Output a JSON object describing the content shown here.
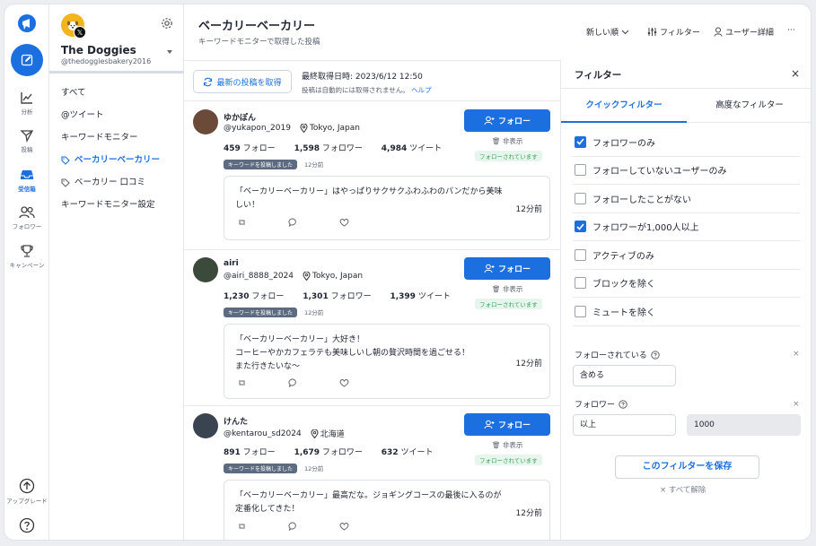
{
  "rail": {
    "items": [
      {
        "label": "分析",
        "icon": "chart-icon"
      },
      {
        "label": "投稿",
        "icon": "send-icon"
      },
      {
        "label": "受信箱",
        "icon": "inbox-icon"
      },
      {
        "label": "フォロワー",
        "icon": "users-icon"
      },
      {
        "label": "キャンペーン",
        "icon": "trophy-icon"
      }
    ],
    "upgrade": "アップグレード",
    "accent": "#1b6fde"
  },
  "account": {
    "name": "The Doggies",
    "handle": "@thedoggiesbakery2016",
    "nav": [
      "すべて",
      "@ツイート",
      "キーワードモニター",
      "ベーカリーベーカリー",
      "ベーカリー 口コミ",
      "キーワードモニター設定"
    ]
  },
  "main": {
    "title": "ベーカリーベーカリー",
    "subtitle": "キーワードモニターで取得した投稿",
    "fetch_button": "最新の投稿を取得",
    "fetch_info": "最終取得日時: 2023/6/12 12:50",
    "fetch_note": "投稿は自動的には取得されません。",
    "help": "ヘルプ"
  },
  "topbar": {
    "sort": "新しい順",
    "filter": "フィルター",
    "user_detail": "ユーザー詳細",
    "more": "···"
  },
  "posts": [
    {
      "name": "ゆかぽん",
      "handle": "@yukapon_2019",
      "location": "Tokyo, Japan",
      "follows": "459",
      "follows_label": "フォロー",
      "followers": "1,598",
      "followers_label": "フォロワー",
      "tweets": "4,984",
      "tweets_label": "ツイート",
      "badge": "キーワードを投稿しました",
      "badge_time": "12分前",
      "follow_button": "フォロー",
      "hide": "非表示",
      "followed_tag": "フォローされています",
      "text": "「ベーカリーベーカリー」はやっぱりサクサクふわふわのパンだから美味しい！",
      "time": "12分前"
    },
    {
      "name": "airi",
      "handle": "@airi_8888_2024",
      "location": "Tokyo, Japan",
      "follows": "1,230",
      "follows_label": "フォロー",
      "followers": "1,301",
      "followers_label": "フォロワー",
      "tweets": "1,399",
      "tweets_label": "ツイート",
      "badge": "キーワードを投稿しました",
      "badge_time": "12分前",
      "follow_button": "フォロー",
      "hide": "非表示",
      "followed_tag": "フォローされています",
      "text": "「ベーカリーベーカリー」大好き！\nコーヒーやかカフェラテも美味しいし朝の贅沢時間を過ごせる！\nまた行きたいな〜",
      "time": "12分前"
    },
    {
      "name": "けんた",
      "handle": "@kentarou_sd2024",
      "location": "北海道",
      "follows": "891",
      "follows_label": "フォロー",
      "followers": "1,679",
      "followers_label": "フォロワー",
      "tweets": "632",
      "tweets_label": "ツイート",
      "badge": "キーワードを投稿しました",
      "badge_time": "12分前",
      "follow_button": "フォロー",
      "hide": "非表示",
      "followed_tag": "フォローされています",
      "text": "「ベーカリーベーカリー」最高だな。ジョギングコースの最後に入るのが定番化してきた！",
      "time": "12分前"
    }
  ],
  "filter": {
    "title": "フィルター",
    "tabs": [
      "クイックフィルター",
      "高度なフィルター"
    ],
    "checks": [
      {
        "label": "フォロワーのみ",
        "checked": true
      },
      {
        "label": "フォローしていないユーザーのみ",
        "checked": false
      },
      {
        "label": "フォローしたことがない",
        "checked": false
      },
      {
        "label": "フォロワーが1,000人以上",
        "checked": true
      },
      {
        "label": "アクティブのみ",
        "checked": false
      },
      {
        "label": "ブロックを除く",
        "checked": false
      },
      {
        "label": "ミュートを除く",
        "checked": false
      }
    ],
    "cond1_label": "フォローされている",
    "cond1_value": "含める",
    "cond2_label": "フォロワー",
    "cond2_op": "以上",
    "cond2_value": "1000",
    "save": "このフィルターを保存",
    "clear": "× すべて解除"
  }
}
